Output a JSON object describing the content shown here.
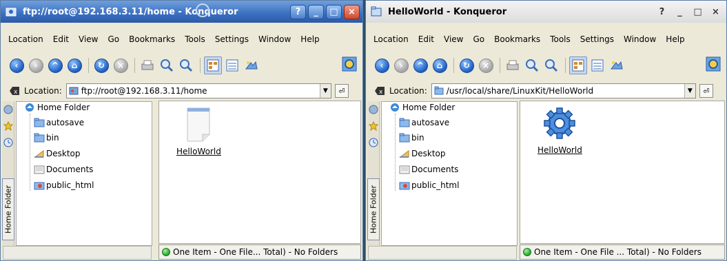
{
  "windows": [
    {
      "title": "ftp://root@192.168.3.11/home - Konqueror",
      "menu": [
        "Location",
        "Edit",
        "View",
        "Go",
        "Bookmarks",
        "Tools",
        "Settings",
        "Window",
        "Help"
      ],
      "location_label": "Location:",
      "location_value": "ftp://root@192.168.3.11/home",
      "sidebar_tab": "Home Folder",
      "tree_root": "Home Folder",
      "tree_items": [
        "autosave",
        "bin",
        "Desktop",
        "Documents",
        "public_html"
      ],
      "file_name": "HelloWorld",
      "file_icon": "document-icon",
      "status": "One Item - One File... Total) - No Folders"
    },
    {
      "title": "HelloWorld - Konqueror",
      "menu": [
        "Location",
        "Edit",
        "View",
        "Go",
        "Bookmarks",
        "Tools",
        "Settings",
        "Window",
        "Help"
      ],
      "location_label": "Location:",
      "location_value": "/usr/local/share/LinuxKit/HelloWorld",
      "sidebar_tab": "Home Folder",
      "tree_root": "Home Folder",
      "tree_items": [
        "autosave",
        "bin",
        "Desktop",
        "Documents",
        "public_html"
      ],
      "file_name": "HelloWorld",
      "file_icon": "gear-executable-icon",
      "status": "One Item - One File ... Total) - No Folders"
    }
  ],
  "title_buttons": {
    "help": "?",
    "minimize": "_",
    "maximize": "□",
    "close": "×"
  },
  "colors": {
    "active_title": "#3a6fc0",
    "inactive_title": "#dcdcdc",
    "accent_blue": "#1f5fc4"
  }
}
